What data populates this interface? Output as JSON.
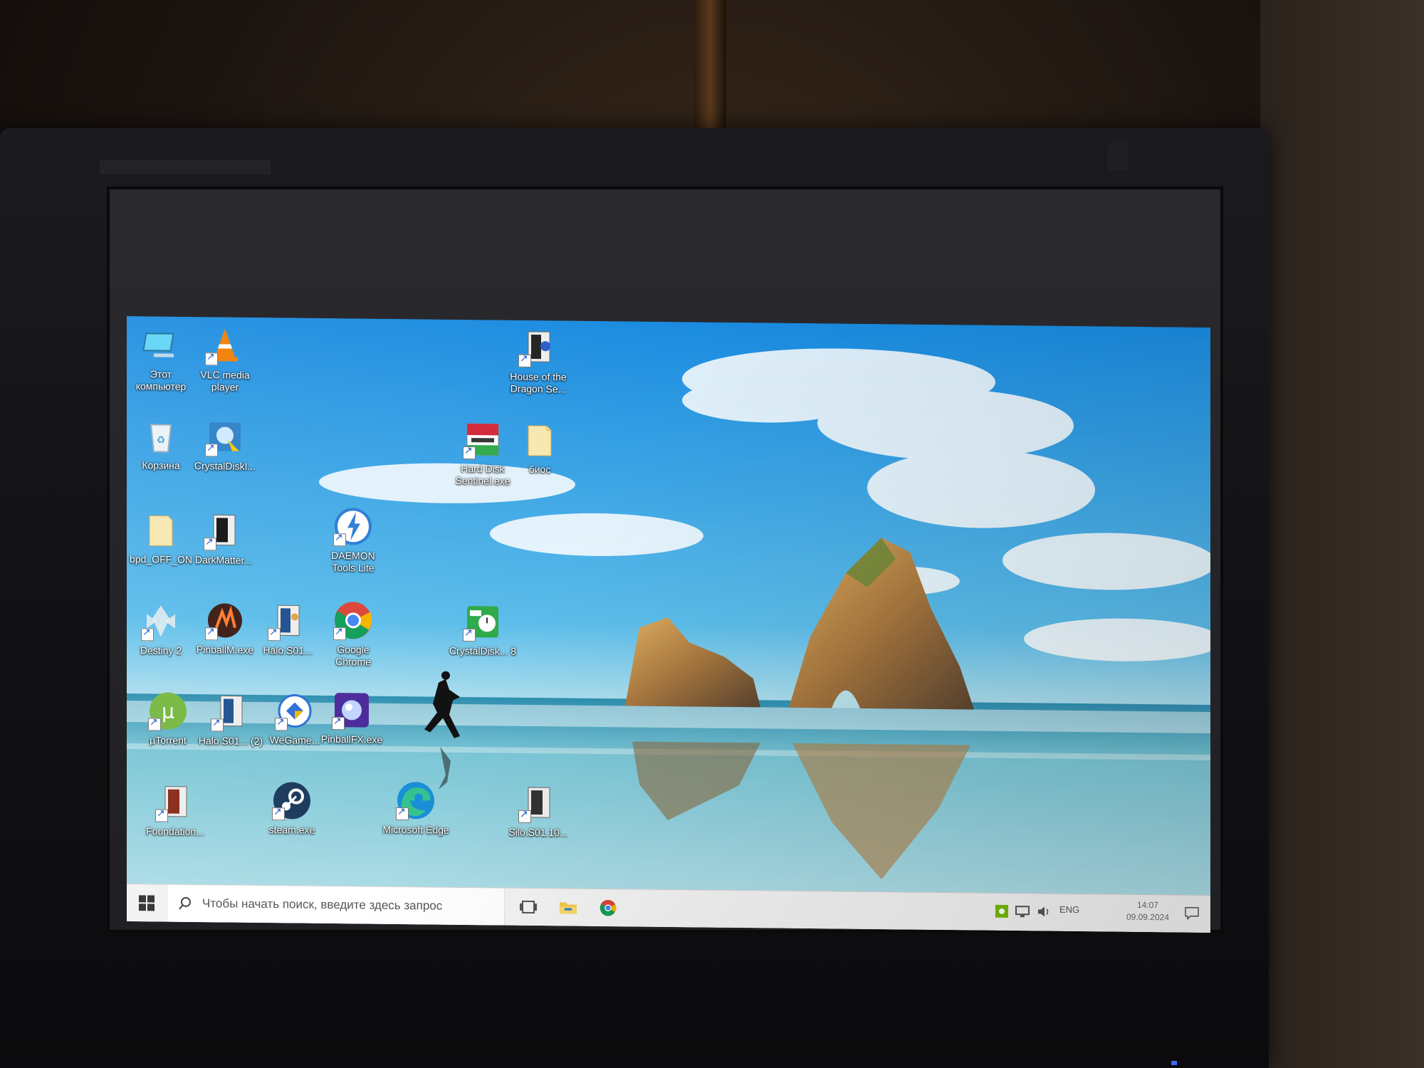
{
  "desktop": {
    "icons": [
      {
        "label": "Этот компьютер",
        "icon": "this-pc-icon"
      },
      {
        "label": "VLC media player",
        "icon": "vlc-icon"
      },
      {
        "label": "House of the Dragon Se...",
        "icon": "movie-file-icon"
      },
      {
        "label": "Корзина",
        "icon": "recycle-bin-icon"
      },
      {
        "label": "CrystalDiskI...",
        "icon": "crystaldiskinfo-icon"
      },
      {
        "label": "Hard Disk Sentinel.exe",
        "icon": "hard-disk-sentinel-icon"
      },
      {
        "label": "биос",
        "icon": "folder-icon"
      },
      {
        "label": "bpd_OFF_ON",
        "icon": "folder-icon"
      },
      {
        "label": "DarkMatter...",
        "icon": "movie-file-icon"
      },
      {
        "label": "DAEMON Tools Lite",
        "icon": "daemon-tools-icon"
      },
      {
        "label": "Destiny 2",
        "icon": "destiny-icon"
      },
      {
        "label": "PinballM.exe",
        "icon": "pinball-m-icon"
      },
      {
        "label": "Halo.S01...",
        "icon": "movie-file-icon"
      },
      {
        "label": "Google Chrome",
        "icon": "chrome-icon"
      },
      {
        "label": "CrystalDisk... 8",
        "icon": "crystaldiskmark-icon"
      },
      {
        "label": "µTorrent",
        "icon": "utorrent-icon"
      },
      {
        "label": "Halo.S01... (2)",
        "icon": "movie-file-icon"
      },
      {
        "label": "WeGame...",
        "icon": "wegame-icon"
      },
      {
        "label": "PinballFX.exe",
        "icon": "pinball-fx-icon"
      },
      {
        "label": "Foundation...",
        "icon": "movie-file-icon"
      },
      {
        "label": "steam.exe",
        "icon": "steam-icon"
      },
      {
        "label": "Microsoft Edge",
        "icon": "edge-icon"
      },
      {
        "label": "Silo.S01.10...",
        "icon": "movie-file-icon"
      }
    ]
  },
  "taskbar": {
    "search_placeholder": "Чтобы начать поиск, введите здесь запрос",
    "pinned": [
      "task-view-icon",
      "file-explorer-icon",
      "chrome-icon"
    ],
    "tray": {
      "language": "ENG",
      "time": "14:07",
      "date": "09.09.2024"
    }
  },
  "colors": {
    "sky_top": "#1c8fe0",
    "sky_mid": "#6cc6f0",
    "sea": "#3aa0b8",
    "sand": "#bfe3ea",
    "taskbar": "#f3f3f3"
  }
}
